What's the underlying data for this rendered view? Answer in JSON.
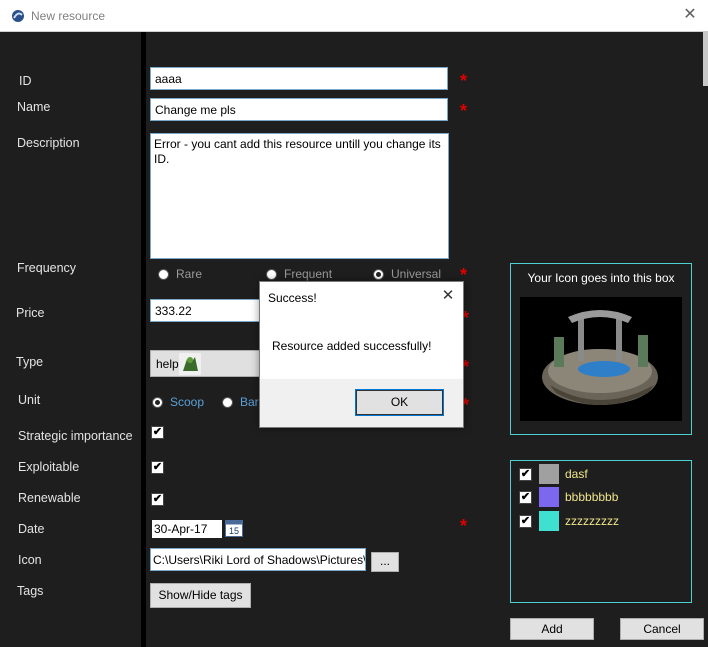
{
  "window": {
    "title": "New resource",
    "close_icon": "✕"
  },
  "labels": {
    "id": "ID",
    "name": "Name",
    "description": "Description",
    "frequency": "Frequency",
    "price": "Price",
    "type": "Type",
    "unit": "Unit",
    "strategic": "Strategic importance",
    "exploitable": "Exploitable",
    "renewable": "Renewable",
    "date": "Date",
    "icon": "Icon",
    "tags": "Tags"
  },
  "fields": {
    "id_value": "aaaa",
    "name_value": "Change me pls",
    "description_value": "Error - you cant add this resource untill you change its ID.",
    "price_value": "333.22",
    "type_value": "help",
    "date_value": "30-Apr-17",
    "calendar_day": "15",
    "icon_path": "C:\\Users\\Riki Lord of Shadows\\Pictures\\I"
  },
  "required_marker": "*",
  "frequency_options": [
    {
      "label": "Rare",
      "selected": false
    },
    {
      "label": "Frequent",
      "selected": false
    },
    {
      "label": "Universal",
      "selected": true
    }
  ],
  "unit_options": [
    {
      "label": "Scoop",
      "selected": true
    },
    {
      "label": "Bar",
      "selected": false
    }
  ],
  "checkboxes": {
    "strategic": true,
    "exploitable": true,
    "renewable": true
  },
  "buttons": {
    "browse": "...",
    "show_hide_tags": "Show/Hide tags",
    "add": "Add",
    "cancel": "Cancel"
  },
  "icon_panel": {
    "title": "Your Icon goes into this box"
  },
  "tags": [
    {
      "label": "dasf",
      "color": "#a0a0a0",
      "checked": true
    },
    {
      "label": "bbbbbbbb",
      "color": "#7b68ee",
      "checked": true
    },
    {
      "label": "zzzzzzzzz",
      "color": "#40e0d0",
      "checked": true
    }
  ],
  "dialog": {
    "title": "Success!",
    "message": "Resource added successfully!",
    "ok_label": "OK",
    "close_icon": "✕"
  },
  "colors": {
    "background": "#1e1e1e",
    "accent_border": "#4fd0d0",
    "required": "#e00000",
    "tag_text": "#f0e68c"
  }
}
